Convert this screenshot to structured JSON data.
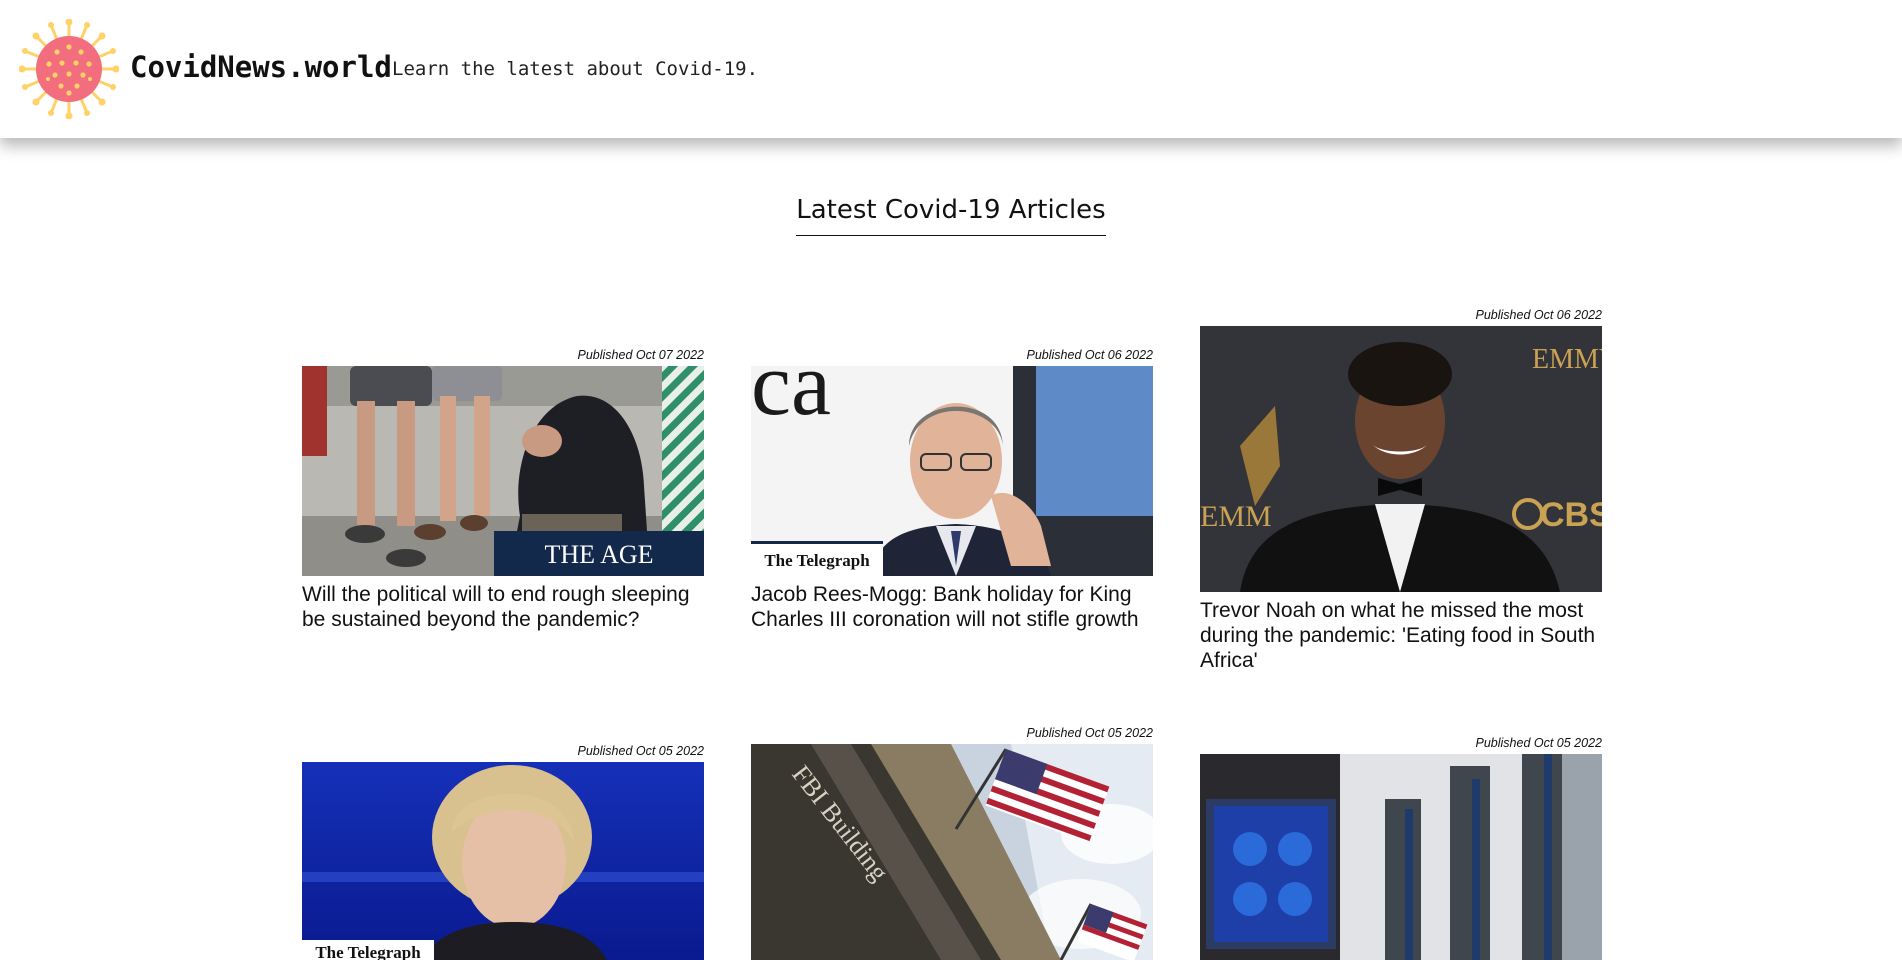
{
  "header": {
    "brand": "CovidNews.world",
    "tagline": "Learn the latest about Covid-19."
  },
  "section": {
    "title": "Latest Covid-19 Articles"
  },
  "articles": [
    {
      "published": "Published Oct 07 2022",
      "title": "Will the political will to end rough sleeping be sustained beyond the pandemic?",
      "source_badge": "THE AGE"
    },
    {
      "published": "Published Oct 06 2022",
      "title": "Jacob Rees-Mogg: Bank holiday for King Charles III coronation will not stifle growth",
      "source_badge": "The Telegraph"
    },
    {
      "published": "Published Oct 06 2022",
      "title": "Trevor Noah on what he missed the most during the pandemic: 'Eating food in South Africa'",
      "image_text": [
        "EMMY",
        "EMM",
        "CBS"
      ]
    },
    {
      "published": "Published Oct 05 2022",
      "title": "",
      "source_badge": "The Telegraph"
    },
    {
      "published": "Published Oct 05 2022",
      "title": "",
      "image_text": "FBI Building"
    },
    {
      "published": "Published Oct 05 2022",
      "title": ""
    }
  ],
  "colors": {
    "virus_body": "#f26d7d",
    "virus_spikes": "#ffd166",
    "badge_bg": "#13294b"
  },
  "icons": {
    "logo": "virus-icon"
  }
}
